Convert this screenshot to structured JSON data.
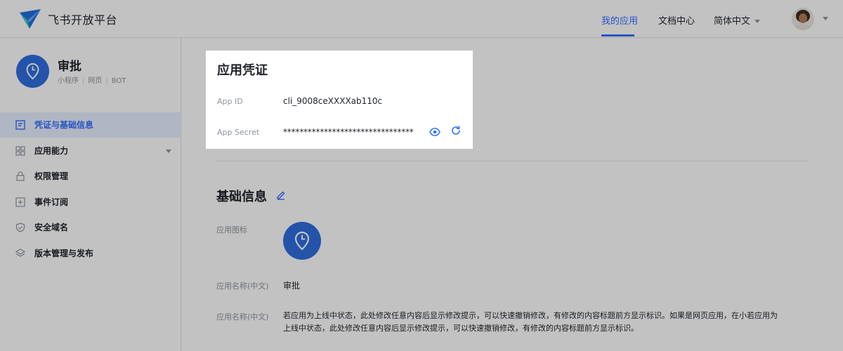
{
  "topbar": {
    "brand": "飞书开放平台",
    "nav": [
      {
        "label": "我的应用"
      },
      {
        "label": "文档中心"
      },
      {
        "label": "简体中文"
      }
    ]
  },
  "sidebar": {
    "app_name": "审批",
    "app_tags": [
      "小程序",
      "网页",
      "BOT"
    ],
    "menu": [
      {
        "label": "凭证与基础信息",
        "icon": "document-icon"
      },
      {
        "label": "应用能力",
        "icon": "grid-icon"
      },
      {
        "label": "权限管理",
        "icon": "lock-icon"
      },
      {
        "label": "事件订阅",
        "icon": "plus-square-icon"
      },
      {
        "label": "安全域名",
        "icon": "shield-icon"
      },
      {
        "label": "版本管理与发布",
        "icon": "layers-icon"
      }
    ]
  },
  "credentials": {
    "title": "应用凭证",
    "app_id_label": "App ID",
    "app_id_value": "cli_9008ceXXXXab110c",
    "app_secret_label": "App Secret",
    "app_secret_value": "********************************"
  },
  "basic_info": {
    "title": "基础信息",
    "icon_label": "应用图标",
    "name_label": "应用名称(中文)",
    "name_value": "审批",
    "desc_label": "应用名称(中文)",
    "desc_line1": "若应用为上线中状态，此处修改任意内容后显示修改提示，可以快速撤销修改，有修改的内容标题前方显示标识。如果是网页应用，在小若应用为",
    "desc_line2": "上线中状态，此处修改任意内容后显示修改提示，可以快速撤销修改，有修改的内容标题前方显示标识。"
  },
  "colors": {
    "accent": "#3370ff",
    "app_icon": "#2f6fe0"
  }
}
